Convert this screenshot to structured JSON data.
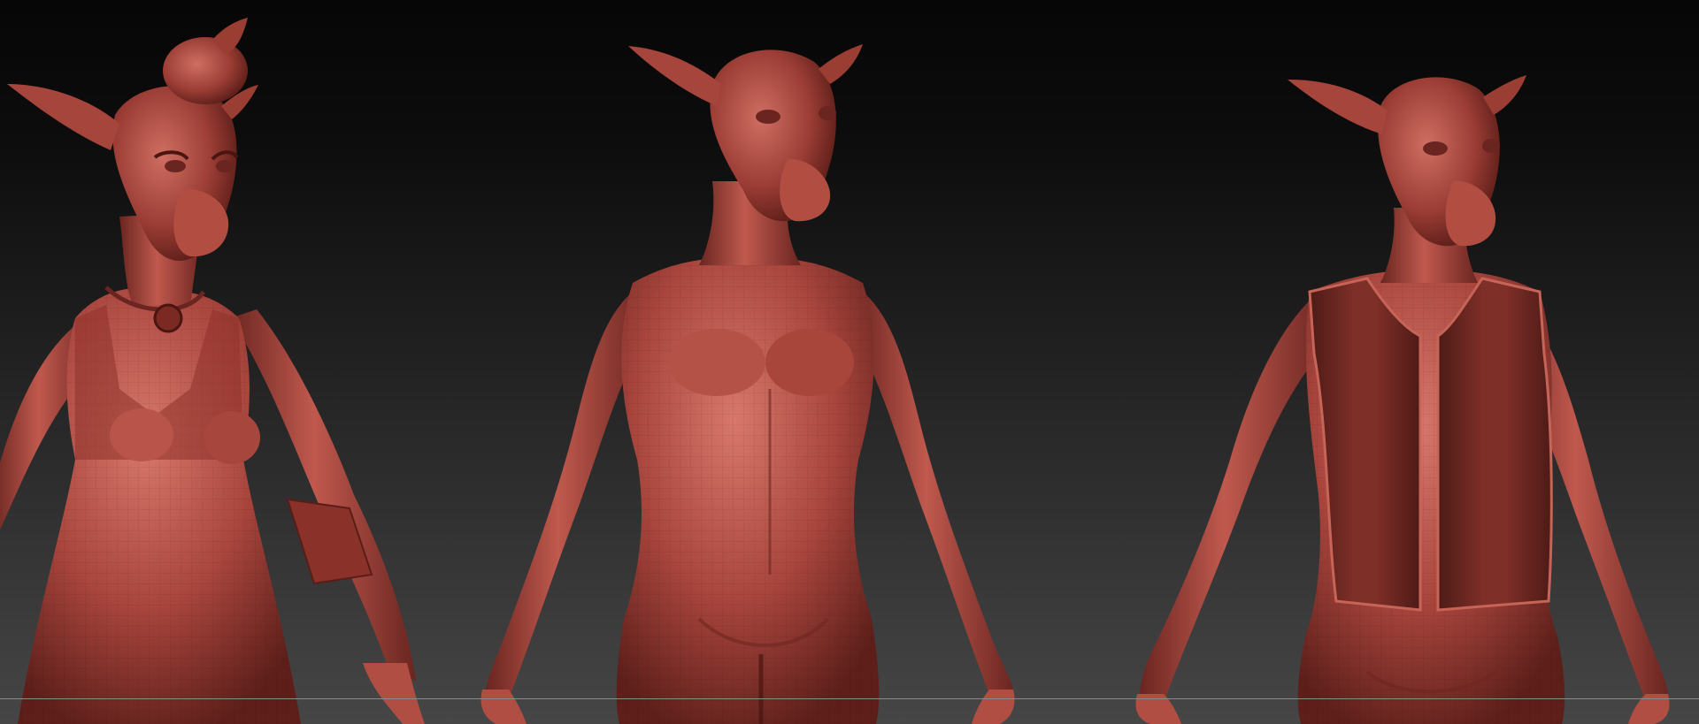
{
  "scene": {
    "material_color": "#a8453d",
    "material_dark": "#6e2620",
    "material_light": "#d8786c",
    "garment_color": "#7a2e27",
    "background_top": "#060606",
    "background_bottom": "#464646",
    "floor_line_color": "#8a8a8a"
  },
  "figures": [
    {
      "label": "female-goat-figure"
    },
    {
      "label": "nude-goat-figure"
    },
    {
      "label": "vested-goat-figure"
    }
  ]
}
